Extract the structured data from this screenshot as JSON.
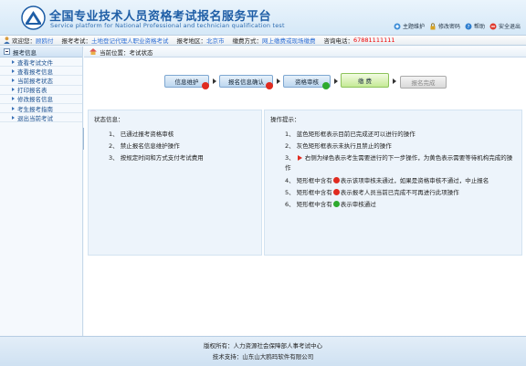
{
  "header": {
    "title_cn": "全国专业技术人员资格考试报名服务平台",
    "title_en": "Service platform for National Professional and technician qualification test",
    "links": [
      {
        "label": "主题维护",
        "icon": "theme-icon"
      },
      {
        "label": "修改密码",
        "icon": "lock-icon"
      },
      {
        "label": "帮助",
        "icon": "help-icon"
      },
      {
        "label": "安全退出",
        "icon": "exit-icon"
      }
    ]
  },
  "infobar": {
    "welcome_label": "欢迎您：",
    "user_name": "顾鸥付",
    "exam_label": "报考考试：",
    "exam_value": "土地登记代理人职业资格考试",
    "region_label": "报考地区：",
    "region_value": "北京市",
    "pay_label": "缴费方式：",
    "pay_value": "网上缴费或现场缴费",
    "phone_label": "咨询电话：",
    "phone_value": "67881111111"
  },
  "sidebar": {
    "title": "报考信息",
    "items": [
      {
        "label": "查看考试文件"
      },
      {
        "label": "查看报考信息"
      },
      {
        "label": "当前报考状态"
      },
      {
        "label": "打印报名表"
      },
      {
        "label": "修改报名信息"
      },
      {
        "label": "考生报考指南"
      },
      {
        "label": "退出当前考试"
      }
    ]
  },
  "crumb": {
    "prefix": "当前位置：",
    "current": "考试状态"
  },
  "steps": [
    {
      "label": "信息维护",
      "state": "done",
      "mark": "stop"
    },
    {
      "label": "报名信息确认",
      "state": "done",
      "mark": "arrow"
    },
    {
      "label": "资格审核",
      "state": "done",
      "mark": "check"
    },
    {
      "label": "缴 费",
      "state": "current",
      "mark": ""
    },
    {
      "label": "报名完成",
      "state": "todo",
      "mark": ""
    }
  ],
  "status_panel": {
    "title": "状态信息：",
    "items": [
      "1、 已通过报考资格审核",
      "2、 禁止报名信息维护操作",
      "3、 按规定时间和方式支付考试费用"
    ]
  },
  "tips_panel": {
    "title": "操作提示：",
    "t1": "1、 蓝色矩形框表示目前已完成还可以进行的操作",
    "t2": "2、 灰色矩形框表示未执行且禁止的操作",
    "t3a": "3、",
    "t3b": "右侧为绿色表示考生需要进行的下一步操作，为黄色表示需要等待机构完成的操作",
    "t4a": "4、 矩形框中含有",
    "t4b": "表示该项审核未通过，如果是资格审核不通过，中止报名",
    "t5a": "5、 矩形框中含有",
    "t5b": "表示报考人员当前已完成不可再进行此项操作",
    "t6a": "6、 矩形框中含有",
    "t6b": "表示审核通过"
  },
  "footer": {
    "line1": "版权所有：人力资源社会保障部人事考试中心",
    "line2": "技术支持：山东山大鸥玛软件有限公司"
  },
  "colors": {
    "accent": "#1f5ea6",
    "link_blue": "#2c6ed5",
    "phone_red": "#e00000",
    "step_done": "#bcd6ef",
    "step_current": "#c5ea96",
    "step_todo": "#d9d9d9"
  }
}
